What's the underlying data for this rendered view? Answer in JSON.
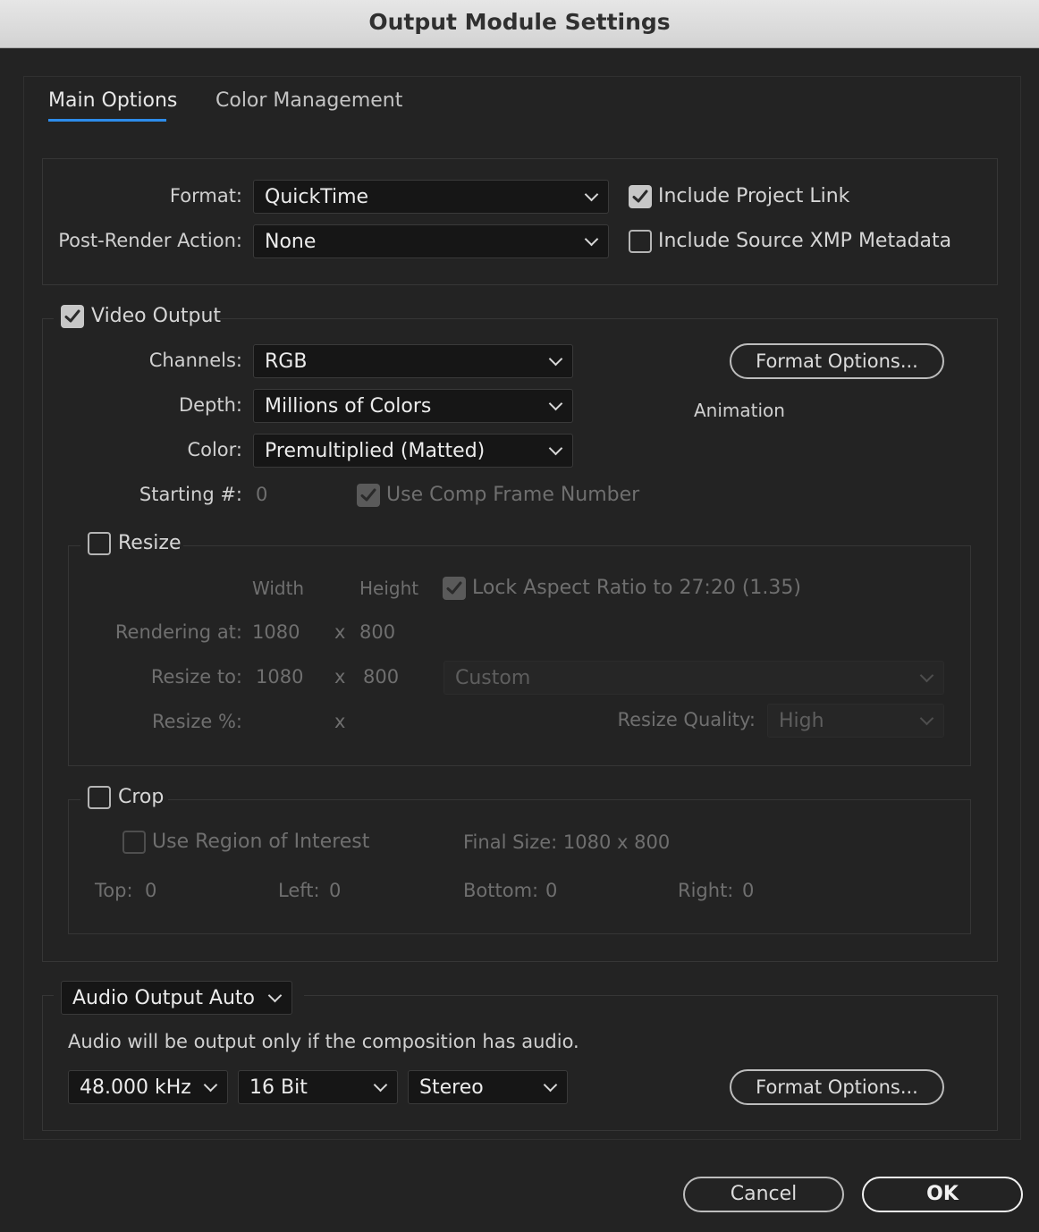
{
  "window": {
    "title": "Output Module Settings"
  },
  "tabs": [
    {
      "label": "Main Options"
    },
    {
      "label": "Color Management"
    }
  ],
  "main": {
    "format_label": "Format:",
    "format_value": "QuickTime",
    "post_render_label": "Post-Render Action:",
    "post_render_value": "None",
    "include_project_link": {
      "label": "Include Project Link",
      "checked": true
    },
    "include_xmp": {
      "label": "Include Source XMP Metadata",
      "checked": false
    }
  },
  "video": {
    "enabled_label": "Video Output",
    "checked": true,
    "channels_label": "Channels:",
    "channels_value": "RGB",
    "depth_label": "Depth:",
    "depth_value": "Millions of Colors",
    "color_label": "Color:",
    "color_value": "Premultiplied (Matted)",
    "starting_label": "Starting #:",
    "starting_value": "0",
    "use_comp_frame": {
      "label": "Use Comp Frame Number",
      "checked": true
    },
    "format_options_label": "Format Options...",
    "codec": "Animation"
  },
  "resize": {
    "label": "Resize",
    "checked": false,
    "width_header": "Width",
    "height_header": "Height",
    "lock_aspect": {
      "label": "Lock Aspect Ratio to 27:20 (1.35)",
      "checked": true
    },
    "rendering_label": "Rendering at:",
    "rendering_w": "1080",
    "rendering_h": "800",
    "x_sep": "x",
    "resize_to_label": "Resize to:",
    "resize_to_w": "1080",
    "resize_to_h": "800",
    "preset_value": "Custom",
    "percent_label": "Resize %:",
    "quality_label": "Resize Quality:",
    "quality_value": "High"
  },
  "crop": {
    "label": "Crop",
    "checked": false,
    "roi": {
      "label": "Use Region of Interest",
      "checked": false
    },
    "final_size": "Final Size: 1080 x 800",
    "top_label": "Top:",
    "top_value": "0",
    "left_label": "Left:",
    "left_value": "0",
    "bottom_label": "Bottom:",
    "bottom_value": "0",
    "right_label": "Right:",
    "right_value": "0"
  },
  "audio": {
    "mode_value": "Audio Output Auto",
    "note": "Audio will be output only if the composition has audio.",
    "rate_value": "48.000 kHz",
    "depth_value": "16 Bit",
    "channels_value": "Stereo",
    "format_options_label": "Format Options..."
  },
  "footer": {
    "cancel_label": "Cancel",
    "ok_label": "OK"
  },
  "colors": {
    "tab_accent": "#2d8ceb",
    "background": "#232323",
    "field": "#161616"
  }
}
